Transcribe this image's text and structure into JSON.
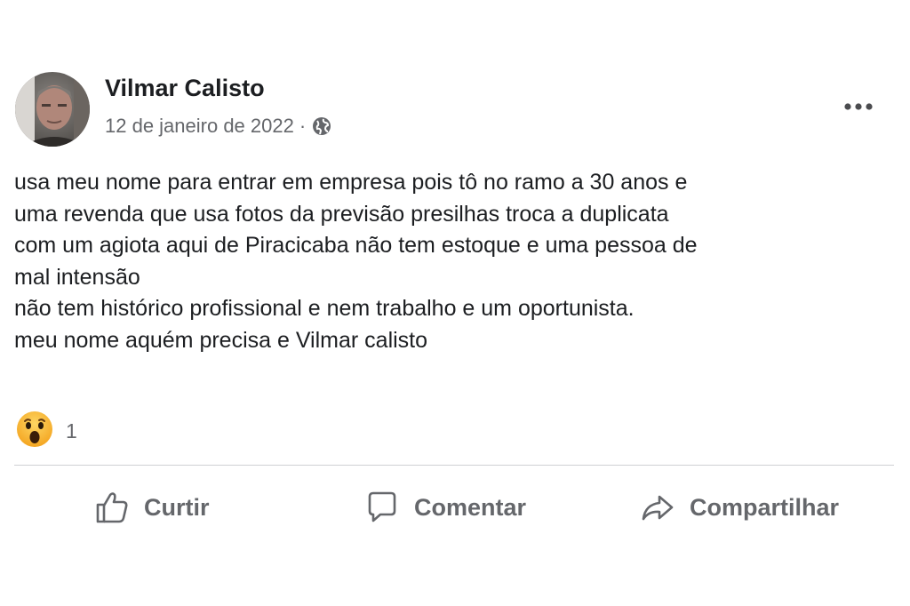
{
  "post": {
    "author": "Vilmar Calisto",
    "date": "12 de janeiro de 2022",
    "separator": "·",
    "privacy_icon": "globe-icon",
    "more_icon": "more-options-icon",
    "body_lines": [
      "usa meu nome para entrar em empresa pois tô no ramo a 30 anos e",
      "uma revenda que usa fotos da previsão presilhas troca a duplicata",
      "com um agiota aqui de Piracicaba não tem estoque e uma pessoa de",
      "mal intensão",
      "não tem histórico profissional e nem trabalho e um oportunista.",
      "meu nome aquém precisa e Vilmar calisto"
    ]
  },
  "reactions": {
    "icon": "wow-reaction-icon",
    "count": "1"
  },
  "actions": {
    "like_label": "Curtir",
    "comment_label": "Comentar",
    "share_label": "Compartilhar"
  },
  "colors": {
    "secondary_text": "#65676b",
    "divider": "#ced0d4",
    "wow_yellow": "#f7b125"
  }
}
